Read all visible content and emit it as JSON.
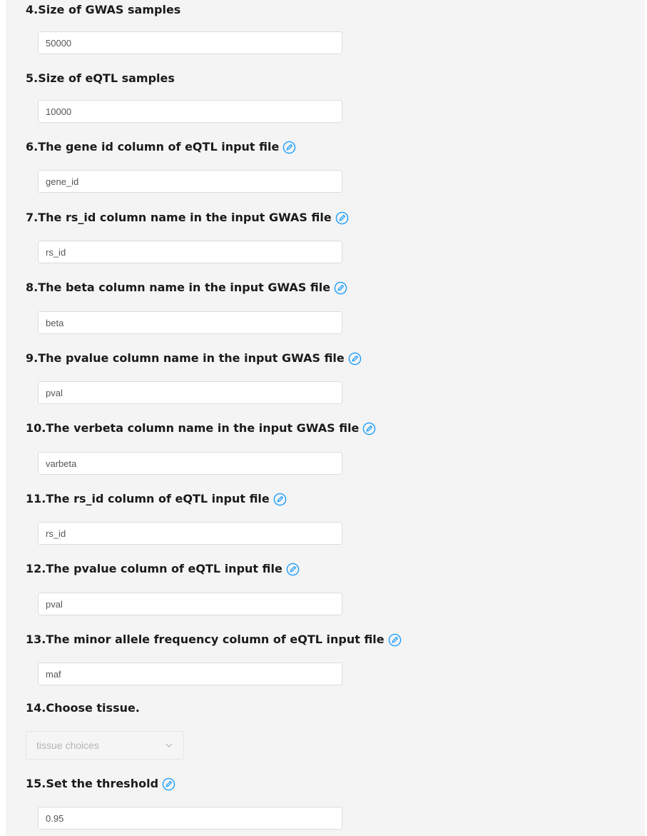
{
  "fields": [
    {
      "label": "4.Size of GWAS samples",
      "value": "50000"
    },
    {
      "label": "5.Size of eQTL samples",
      "value": "10000"
    },
    {
      "label": "6.The gene id column of eQTL input file",
      "value": "gene_id"
    },
    {
      "label": "7.The rs_id column name in the input GWAS file",
      "value": "rs_id"
    },
    {
      "label": "8.The beta column name in the input GWAS file",
      "value": "beta"
    },
    {
      "label": "9.The pvalue column name in the input GWAS file",
      "value": "pval"
    },
    {
      "label": "10.The verbeta column name in the input GWAS file",
      "value": "varbeta"
    },
    {
      "label": "11.The rs_id column of eQTL input file",
      "value": "rs_id"
    },
    {
      "label": "12.The pvalue column of eQTL input file",
      "value": "pval"
    },
    {
      "label": "13.The minor allele frequency column of eQTL input file",
      "value": "maf"
    }
  ],
  "tissue": {
    "label": "14.Choose tissue.",
    "placeholder": "tissue choices"
  },
  "threshold": {
    "label": "15.Set the threshold",
    "value": "0.95"
  },
  "icons": {
    "edit": "edit-circle-icon",
    "chevron": "chevron-down-icon"
  },
  "colors": {
    "accent": "#1e9fff",
    "panel_bg": "#f4f4f4",
    "label_text": "#1a1a1a"
  }
}
